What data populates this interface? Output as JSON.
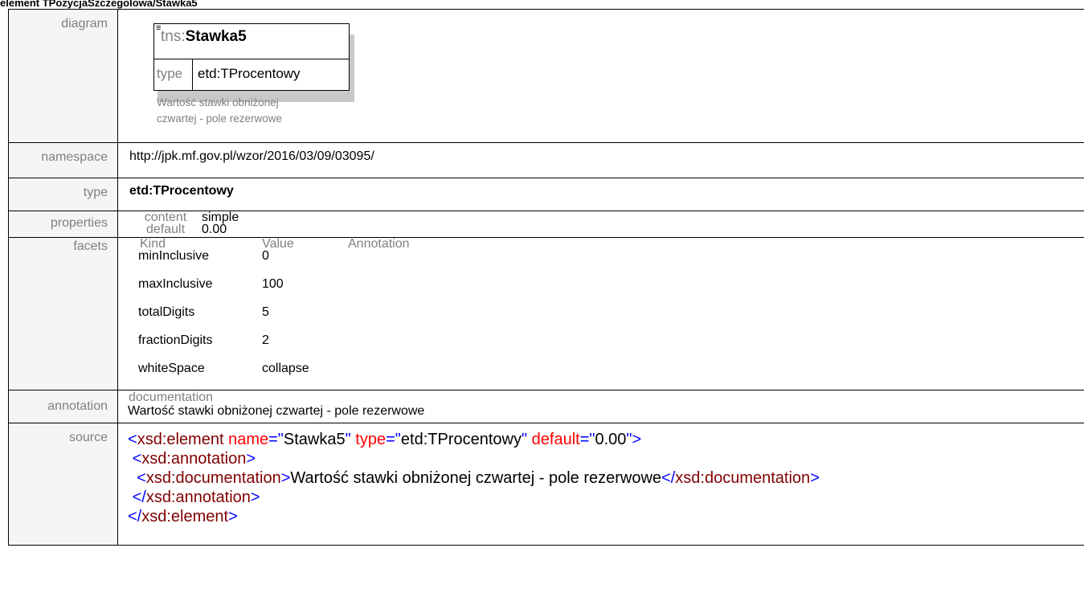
{
  "title": "element TPozycjaSzczegolowa/Stawka5",
  "labels": {
    "diagram": "diagram",
    "namespace": "namespace",
    "type": "type",
    "properties": "properties",
    "facets": "facets",
    "annotation": "annotation",
    "source": "source"
  },
  "diagram": {
    "prefix": "tns:",
    "name": "Stawka5",
    "type_label": "type",
    "type_value": "etd:TProcentowy",
    "doc_line1": "Wartość stawki obniżonej",
    "doc_line2": "czwartej - pole rezerwowe"
  },
  "namespace": "http://jpk.mf.gov.pl/wzor/2016/03/09/03095/",
  "type": "etd:TProcentowy",
  "properties": [
    {
      "key": "content",
      "value": "simple"
    },
    {
      "key": "default",
      "value": "0.00"
    }
  ],
  "facets": {
    "headers": {
      "kind": "Kind",
      "value": "Value",
      "annotation": "Annotation"
    },
    "rows": [
      {
        "kind": "minInclusive",
        "value": "0"
      },
      {
        "kind": "maxInclusive",
        "value": "100"
      },
      {
        "kind": "totalDigits",
        "value": "5"
      },
      {
        "kind": "fractionDigits",
        "value": "2"
      },
      {
        "kind": "whiteSpace",
        "value": "collapse"
      }
    ]
  },
  "annotation": {
    "header": "documentation",
    "text": "Wartość stawki obniżonej czwartej - pole rezerwowe"
  },
  "source": {
    "open_tag": "xsd:element",
    "attr_name": "name",
    "attr_name_value": "Stawka5",
    "attr_type": "type",
    "attr_type_value": "etd:TProcentowy",
    "attr_default": "default",
    "attr_default_value": "0.00",
    "annotation_tag": "xsd:annotation",
    "documentation_tag": "xsd:documentation",
    "documentation_text": "Wartość stawki obniżonej czwartej - pole rezerwowe"
  },
  "colors": {
    "tag": "#0000ff",
    "element_name": "#800000",
    "attr_name": "#ff0000",
    "label_text": "#808080"
  }
}
